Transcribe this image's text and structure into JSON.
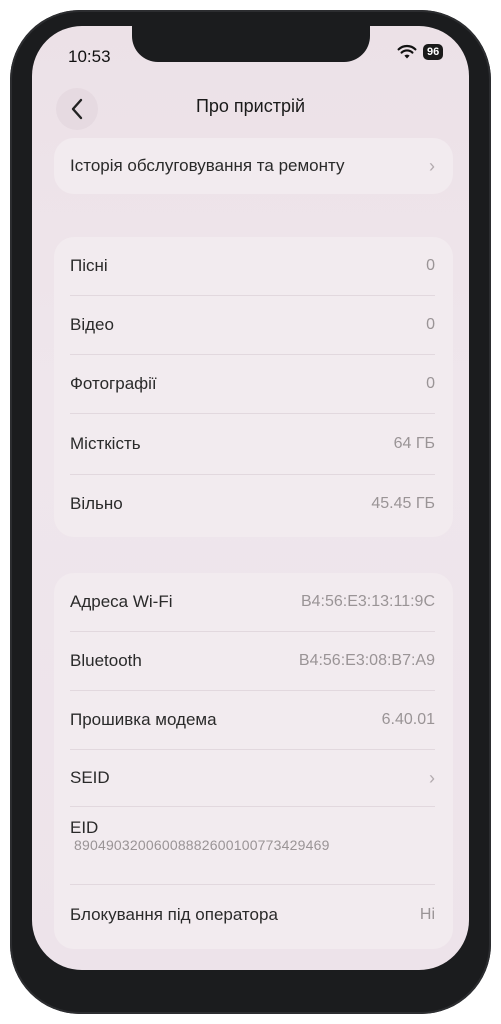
{
  "status": {
    "time": "10:53",
    "battery": "96"
  },
  "header": {
    "title": "Про пристрій"
  },
  "service": {
    "label": "Історія обслуговування та ремонту"
  },
  "media": [
    {
      "label": "Пісні",
      "value": "0"
    },
    {
      "label": "Відео",
      "value": "0"
    },
    {
      "label": "Фотографії",
      "value": "0"
    },
    {
      "label": "Місткість",
      "value": "64 ГБ"
    },
    {
      "label": "Вільно",
      "value": "45.45 ГБ"
    }
  ],
  "network": {
    "wifi": {
      "label": "Адреса Wi-Fi",
      "value": "B4:56:E3:13:11:9C"
    },
    "bluetooth": {
      "label": "Bluetooth",
      "value": "B4:56:E3:08:B7:A9"
    },
    "modem": {
      "label": "Прошивка модема",
      "value": "6.40.01"
    },
    "seid": {
      "label": "SEID"
    },
    "eid": {
      "label": "EID",
      "value": "89049032006008882600100773429469"
    },
    "carrier_lock": {
      "label": "Блокування під оператора",
      "value": "Ні"
    }
  }
}
